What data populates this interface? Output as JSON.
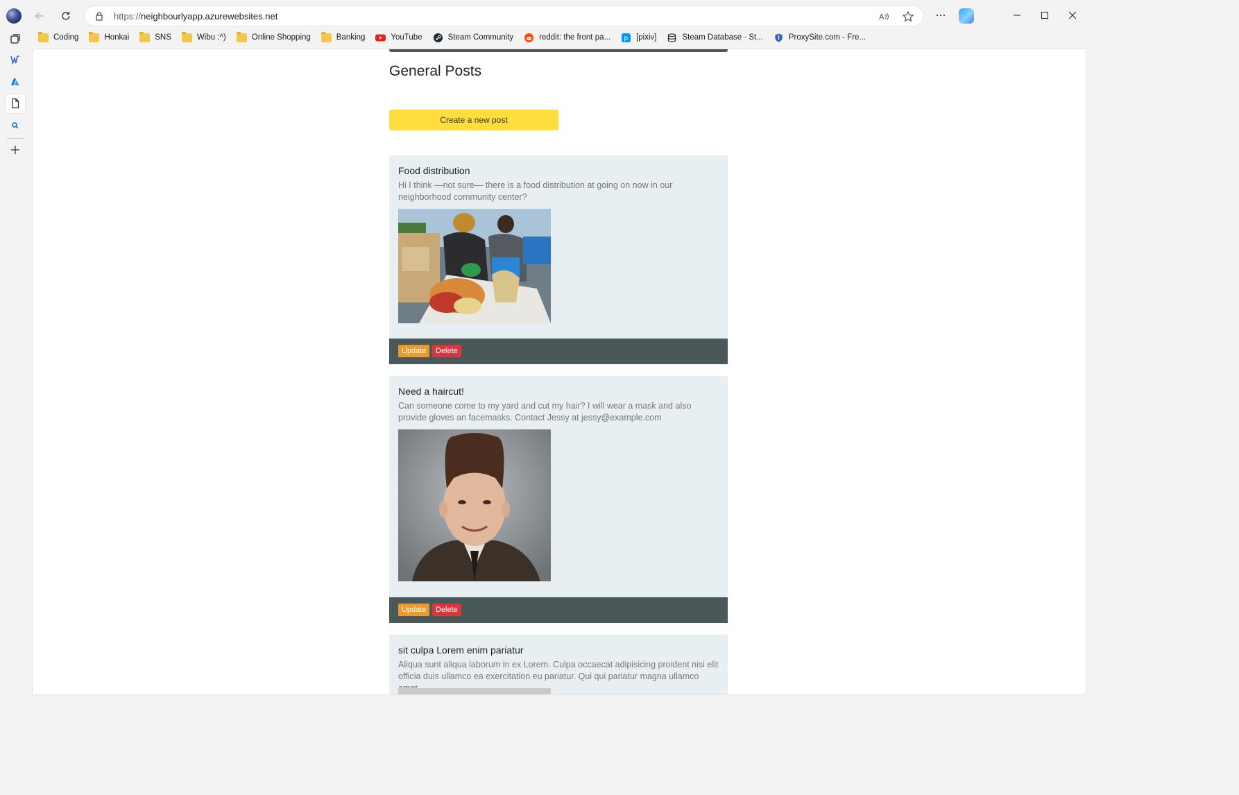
{
  "browser": {
    "url_protocol": "https://",
    "url_host": "neighbourlyapp.azurewebsites.net"
  },
  "bookmarks": [
    {
      "label": "Coding",
      "icon": "folder-icon"
    },
    {
      "label": "Honkai",
      "icon": "folder-icon"
    },
    {
      "label": "SNS",
      "icon": "folder-icon"
    },
    {
      "label": "Wibu :^)",
      "icon": "folder-icon"
    },
    {
      "label": "Online Shopping",
      "icon": "folder-icon"
    },
    {
      "label": "Banking",
      "icon": "folder-icon"
    },
    {
      "label": "YouTube",
      "icon": "youtube-icon"
    },
    {
      "label": "Steam Community",
      "icon": "steam-icon"
    },
    {
      "label": "reddit: the front pa...",
      "icon": "reddit-icon"
    },
    {
      "label": "[pixiv]",
      "icon": "pixiv-icon"
    },
    {
      "label": "Steam Database · St...",
      "icon": "steamdb-icon"
    },
    {
      "label": "ProxySite.com - Fre...",
      "icon": "shield-icon"
    }
  ],
  "page": {
    "title": "General Posts",
    "create_button": "Create a new post"
  },
  "posts": [
    {
      "title": "Food distribution",
      "body": "Hi I think —not sure— there is a food distribution at going on now in our neighborhood community center?",
      "image": "food-distribution-photo",
      "update_label": "Update",
      "delete_label": "Delete"
    },
    {
      "title": "Need a haircut!",
      "body": "Can someone come to my yard and cut my hair? I will wear a mask and also provide gloves an facemasks. Contact Jessy at jessy@example.com",
      "image": "haircut-portrait-photo",
      "update_label": "Update",
      "delete_label": "Delete"
    },
    {
      "title": "sit culpa Lorem enim pariatur",
      "body": "Aliqua sunt aliqua laborum in ex Lorem. Culpa occaecat adipisicing proident nisi elit officia duis ullamco ea exercitation eu pariatur. Qui qui pariatur magna ullamco amet.",
      "image": "placeholder-photo"
    }
  ],
  "colors": {
    "navbar": "#4b5859",
    "create_button": "#ffdd3c",
    "post_background": "#e7eff3",
    "update_button": "#ec9a2b",
    "delete_button": "#d9363e"
  }
}
